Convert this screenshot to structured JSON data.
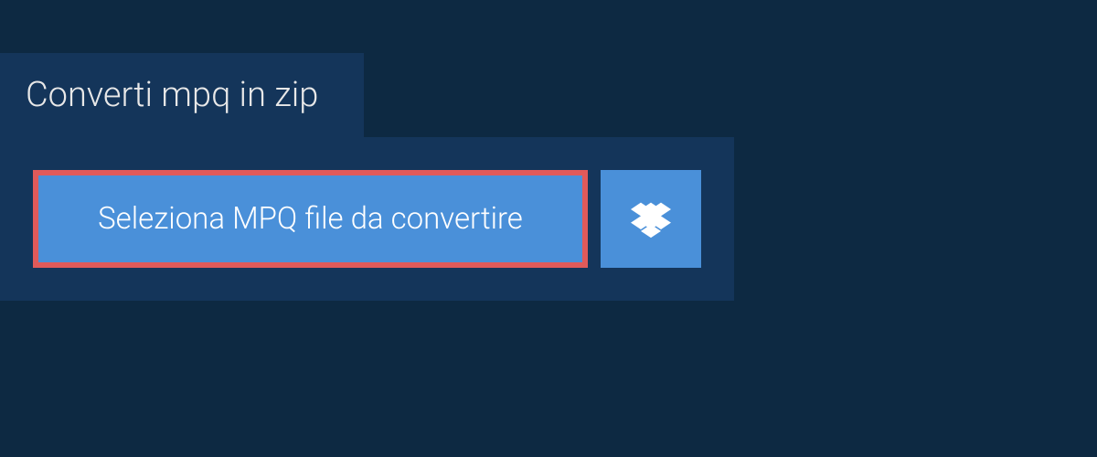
{
  "tab": {
    "title": "Converti mpq in zip"
  },
  "actions": {
    "select_file_label": "Seleziona MPQ file da convertire"
  }
}
